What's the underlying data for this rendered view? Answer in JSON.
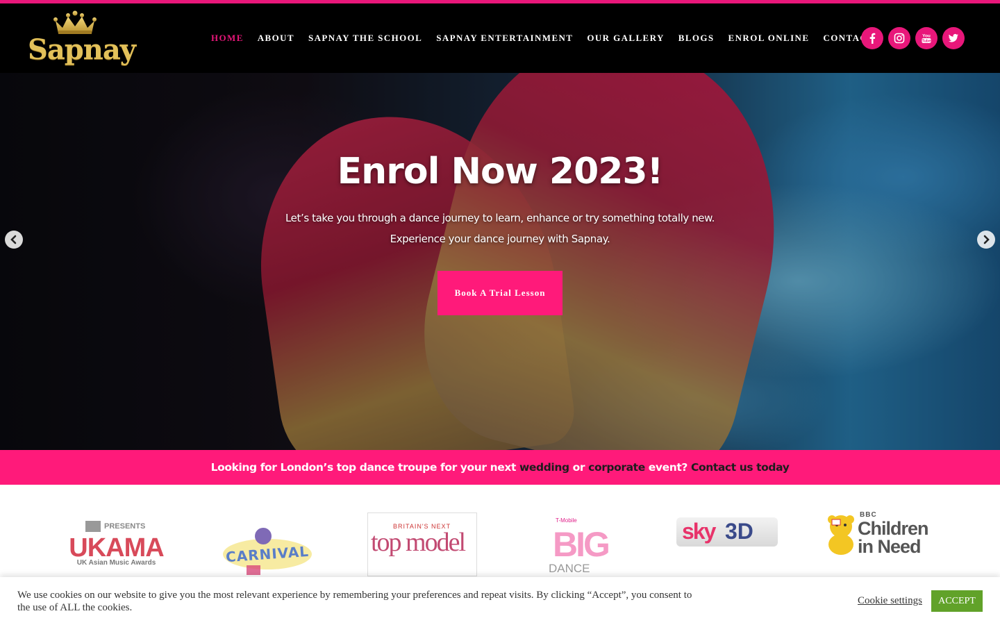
{
  "brand": {
    "name": "Sapnay",
    "gold": "#e3c15a",
    "accent": "#e8177a"
  },
  "nav": {
    "items": [
      {
        "label": "HOME",
        "active": true
      },
      {
        "label": "ABOUT"
      },
      {
        "label": "SAPNAY THE SCHOOL"
      },
      {
        "label": "SAPNAY ENTERTAINMENT"
      },
      {
        "label": "OUR GALLERY"
      },
      {
        "label": "BLOGS"
      },
      {
        "label": "ENROL ONLINE"
      },
      {
        "label": "CONTACT"
      }
    ]
  },
  "social": [
    "facebook-icon",
    "instagram-icon",
    "youtube-icon",
    "twitter-icon"
  ],
  "hero": {
    "title": "Enrol Now 2023!",
    "subtitle": "Let’s take you through a dance journey to learn, enhance or try something totally new. Experience your dance journey with Sapnay.",
    "button": "Book A Trial Lesson"
  },
  "banner": {
    "part1": "Looking for London’s top dance troupe for your next ",
    "link1": "wedding",
    "part2": " or ",
    "link2": "corporate",
    "part3": " event? ",
    "link3": "Contact us today"
  },
  "partners": {
    "ukama_presents": "PRESENTS",
    "ukama_name": "UKAMA",
    "ukama_sub": "UK Asian Music Awards",
    "carnival": "CARNIVAL",
    "topmodel_small": "BRITAIN'S NEXT",
    "topmodel_main": "top model",
    "bigdance_small": "T-Mobile",
    "bigdance_big": "BIG",
    "bigdance_sub": "DANCE",
    "sky": "sky",
    "sky3d": "3D",
    "cin_bbc": "BBC",
    "cin_line1": "Children",
    "cin_line2": "in Need"
  },
  "cookie": {
    "text": "We use cookies on our website to give you the most relevant experience by remembering your preferences and repeat visits. By clicking “Accept”, you consent to the use of ALL the cookies.",
    "settings": "Cookie settings",
    "accept": "ACCEPT"
  }
}
